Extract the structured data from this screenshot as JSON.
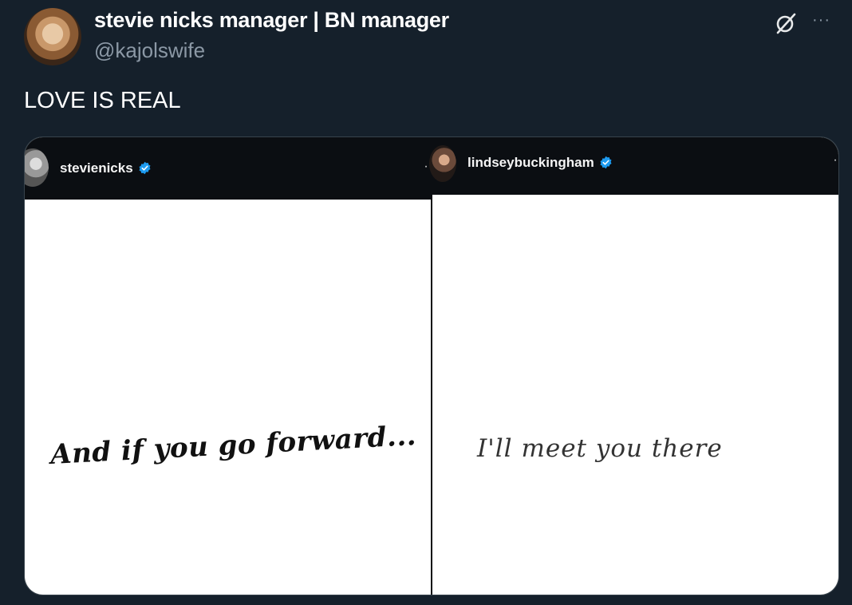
{
  "author": {
    "display_name": "stevie nicks manager | BN manager",
    "handle": "@kajolswife",
    "avatar_icon": "profile-avatar"
  },
  "header_actions": {
    "grok_icon": "grok-icon",
    "more_icon": "more-options-icon",
    "more_glyph": "···"
  },
  "tweet": {
    "text": "LOVE IS REAL"
  },
  "media": {
    "left": {
      "username": "stevienicks",
      "verified": true,
      "more_glyph": "··",
      "handwritten_text": "And if you go forward..."
    },
    "right": {
      "username": "lindseybuckingham",
      "verified": true,
      "more_glyph": "··",
      "handwritten_text": "I'll meet you there"
    }
  },
  "colors": {
    "background": "#15202b",
    "secondary_text": "#8b98a5",
    "verified_blue": "#1d9bf0"
  }
}
